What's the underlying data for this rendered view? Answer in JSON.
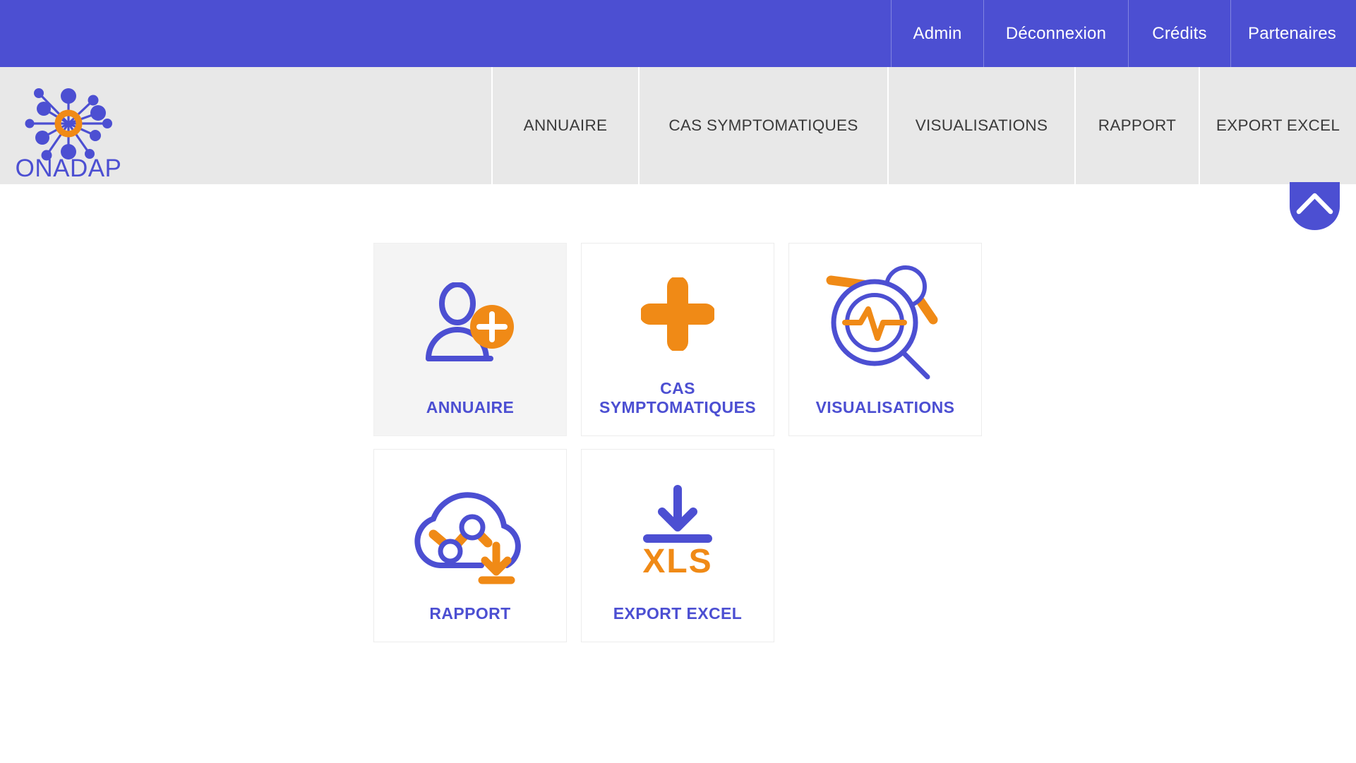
{
  "colors": {
    "brand_blue": "#4C4FD2",
    "brand_orange": "#F08A16",
    "nav_background": "#E8E8E8",
    "card_active_background": "#F4F4F4",
    "page_background": "#FFFFFF"
  },
  "topbar": {
    "items": [
      {
        "label": "Admin"
      },
      {
        "label": "Déconnexion"
      },
      {
        "label": "Crédits"
      },
      {
        "label": "Partenaires"
      }
    ]
  },
  "brand": {
    "logo_text": "ONADAP",
    "logo_icon": "network-nodes-icon"
  },
  "nav": {
    "items": [
      {
        "label": "ANNUAIRE"
      },
      {
        "label": "CAS SYMPTOMATIQUES"
      },
      {
        "label": "VISUALISATIONS"
      },
      {
        "label": "RAPPORT"
      },
      {
        "label": "EXPORT EXCEL"
      }
    ]
  },
  "scroll_top": {
    "icon": "chevron-up-icon"
  },
  "cards": [
    {
      "label": "ANNUAIRE",
      "icon": "user-add-icon",
      "active": true
    },
    {
      "label_line1": "CAS",
      "label_line2": "SYMPTOMATIQUES",
      "icon": "plus-icon",
      "active": false
    },
    {
      "label": "VISUALISATIONS",
      "icon": "magnifier-pulse-icon",
      "active": false
    },
    {
      "label": "RAPPORT",
      "icon": "cloud-chart-download-icon",
      "active": false
    },
    {
      "label": "EXPORT EXCEL",
      "icon": "xls-download-icon",
      "active": false
    }
  ]
}
